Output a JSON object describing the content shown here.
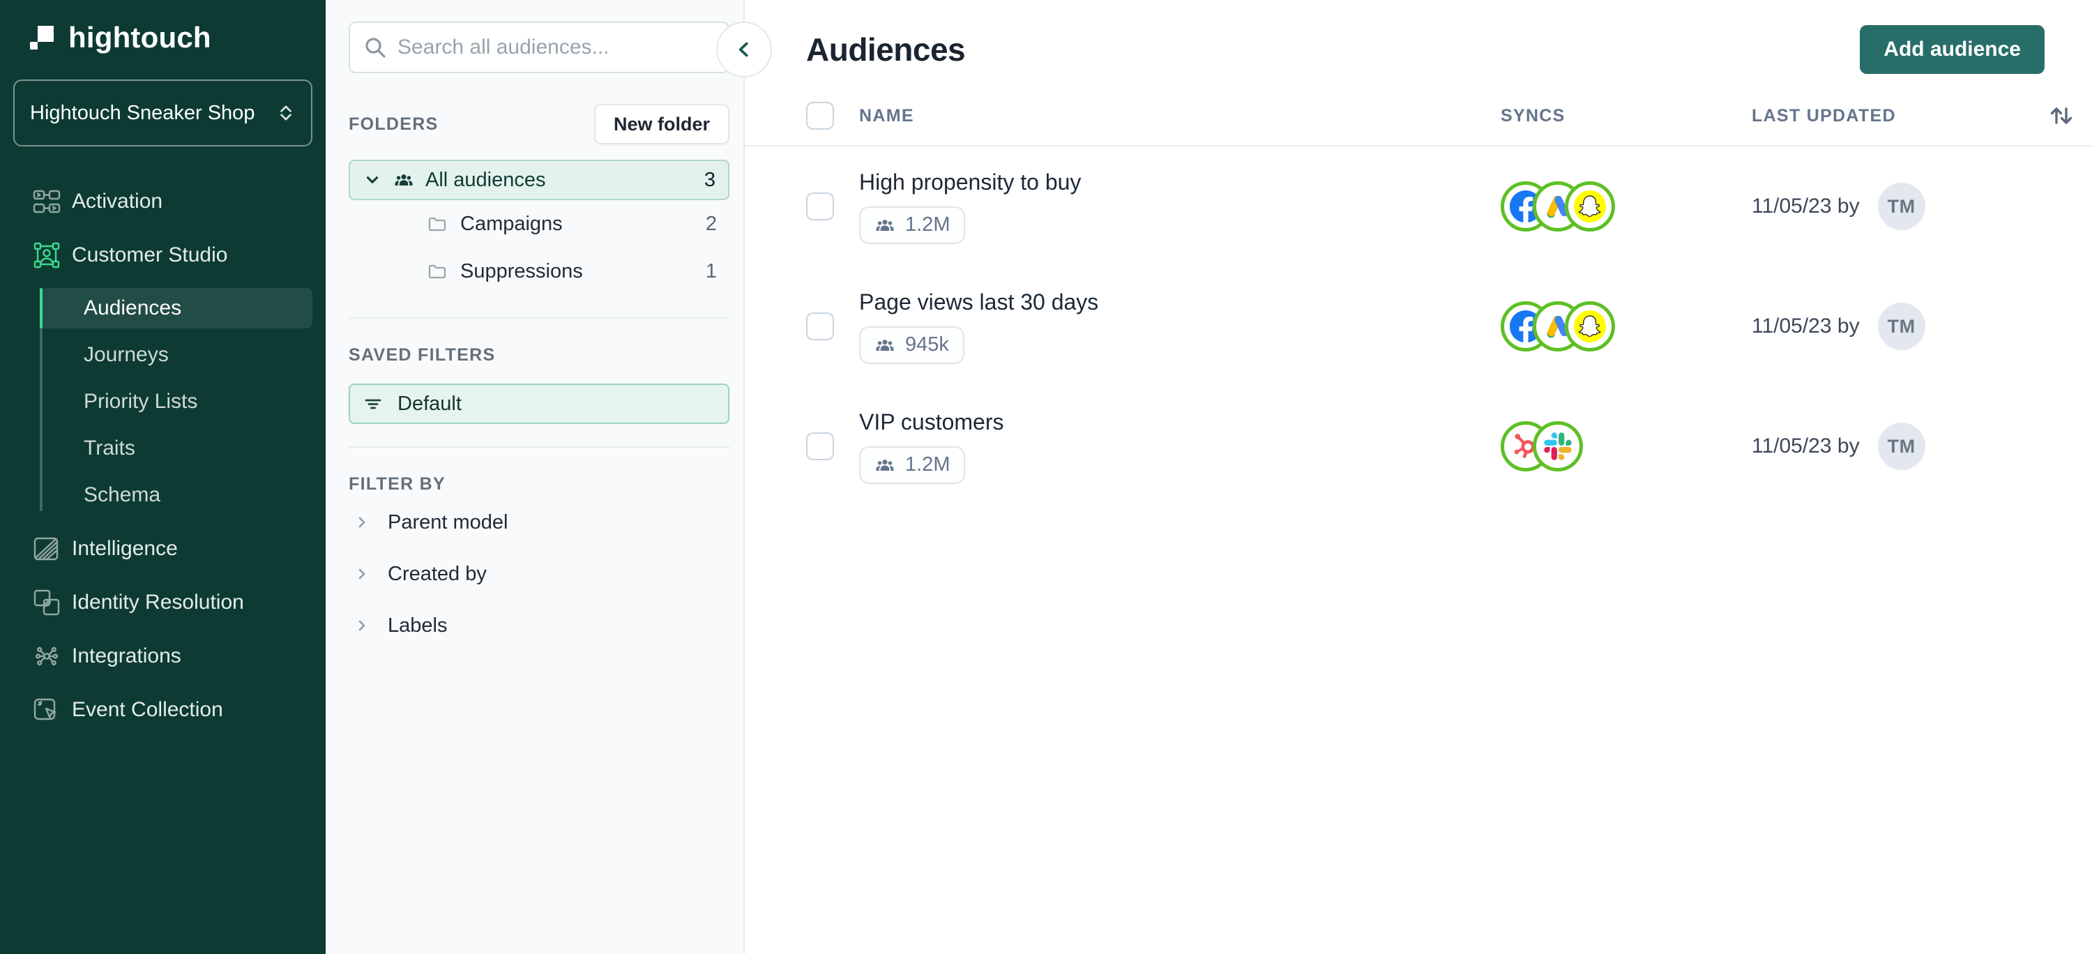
{
  "app": {
    "brand": "hightouch",
    "workspace": "Hightouch Sneaker Shop"
  },
  "sidebar": {
    "activation": "Activation",
    "customer_studio": "Customer Studio",
    "audiences": "Audiences",
    "journeys": "Journeys",
    "priority_lists": "Priority Lists",
    "traits": "Traits",
    "schema": "Schema",
    "intelligence": "Intelligence",
    "identity_resolution": "Identity Resolution",
    "integrations": "Integrations",
    "event_collection": "Event Collection"
  },
  "panel": {
    "search_placeholder": "Search all audiences...",
    "folders_label": "FOLDERS",
    "new_folder_button": "New folder",
    "folders": [
      {
        "name": "All audiences",
        "count": "3"
      },
      {
        "name": "Campaigns",
        "count": "2"
      },
      {
        "name": "Suppressions",
        "count": "1"
      }
    ],
    "saved_filters_label": "SAVED FILTERS",
    "default_filter": "Default",
    "filter_by_label": "FILTER BY",
    "filter_groups": [
      {
        "label": "Parent model"
      },
      {
        "label": "Created by"
      },
      {
        "label": "Labels"
      }
    ]
  },
  "main": {
    "title": "Audiences",
    "add_button": "Add audience",
    "columns": {
      "name": "NAME",
      "syncs": "SYNCS",
      "last_updated": "LAST UPDATED"
    },
    "rows": [
      {
        "name": "High propensity to buy",
        "size": "1.2M",
        "destinations": [
          "facebook",
          "google-ads",
          "snapchat"
        ],
        "updated": "11/05/23 by",
        "avatar": "TM"
      },
      {
        "name": "Page views last 30 days",
        "size": "945k",
        "destinations": [
          "facebook",
          "google-ads",
          "snapchat"
        ],
        "updated": "11/05/23 by",
        "avatar": "TM"
      },
      {
        "name": "VIP customers",
        "size": "1.2M",
        "destinations": [
          "hubspot",
          "slack"
        ],
        "updated": "11/05/23 by",
        "avatar": "TM"
      }
    ]
  },
  "colors": {
    "sidebar_green": "#0D3B34",
    "accent_mint": "#3BDB8C",
    "button_teal": "#276E69",
    "sync_ring_green": "#5FBF25",
    "folder_selected_bg": "#E4F2EE"
  }
}
